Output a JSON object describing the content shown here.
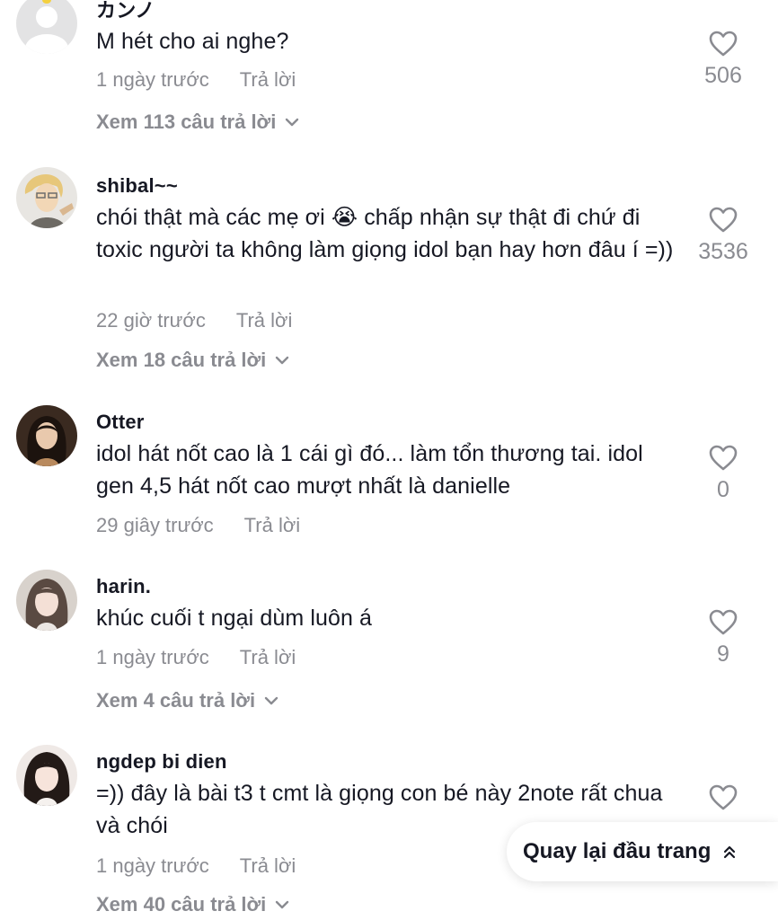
{
  "comments": [
    {
      "username": "カンノ",
      "text": "M hét cho ai nghe?",
      "time": "1 ngày trước",
      "reply_label": "Trả lời",
      "likes": "506",
      "view_replies": "Xem 113 câu trả lời"
    },
    {
      "username": "shibal~~",
      "text": "chói thật mà các mẹ ơi 😭 chấp nhận sự thật đi chứ đi toxic người ta không làm giọng idol bạn hay hơn đâu í =))",
      "time": "22 giờ trước",
      "reply_label": "Trả lời",
      "likes": "3536",
      "view_replies": "Xem 18 câu trả lời"
    },
    {
      "username": "Otter",
      "text": "idol hát nốt cao là 1 cái gì đó... làm tổn thương tai. idol gen 4,5 hát nốt cao mượt nhất là danielle",
      "time": "29 giây trước",
      "reply_label": "Trả lời",
      "likes": "0"
    },
    {
      "username": "harin.",
      "text": "khúc cuối t ngại dùm luôn á",
      "time": "1 ngày trước",
      "reply_label": "Trả lời",
      "likes": "9",
      "view_replies": "Xem 4 câu trả lời"
    },
    {
      "username": "ngdep bi dien",
      "text": "=)) đây là bài t3 t cmt là giọng con bé này 2note rất chua và chói",
      "time": "1 ngày trước",
      "reply_label": "Trả lời",
      "view_replies": "Xem 40 câu trả lời"
    }
  ],
  "back_to_top": {
    "label": "Quay lại đầu trang",
    "icon": "double-chevron-up-icon"
  },
  "icons": {
    "like": "heart-outline-icon",
    "expand": "chevron-down-icon"
  },
  "colors": {
    "text": "#161823",
    "muted": "#8a8b91",
    "background": "#ffffff"
  }
}
